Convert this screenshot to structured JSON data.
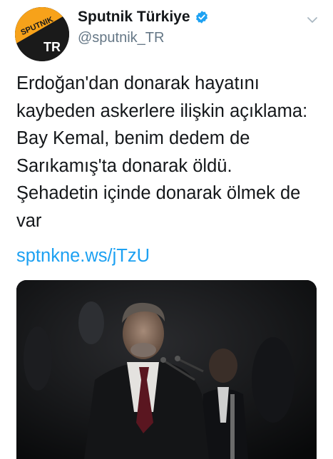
{
  "tweet": {
    "author": {
      "display_name": "Sputnik Türkiye",
      "handle": "@sputnik_TR",
      "avatar": {
        "logo_top": "SPUTNIK",
        "logo_bottom": "TR",
        "colors": {
          "accent": "#f7a21a",
          "background": "#1a1a1a"
        }
      },
      "verified": true
    },
    "text": "Erdoğan'dan donarak hayatını\nkaybeden askerlere ilişkin açıklama:\nBay Kemal, benim dedem de\nSarıkamış'ta donarak öldü.\nŞehadetin içinde donarak ölmek de\nvar",
    "link": "sptnkne.ws/jTzU",
    "media": {
      "type": "photo"
    }
  },
  "colors": {
    "link": "#1da1f2",
    "verified": "#1da1f2",
    "handle": "#657786",
    "text": "#14171a"
  },
  "icons": {
    "verified": "verified-badge-icon",
    "menu": "chevron-down-icon"
  }
}
